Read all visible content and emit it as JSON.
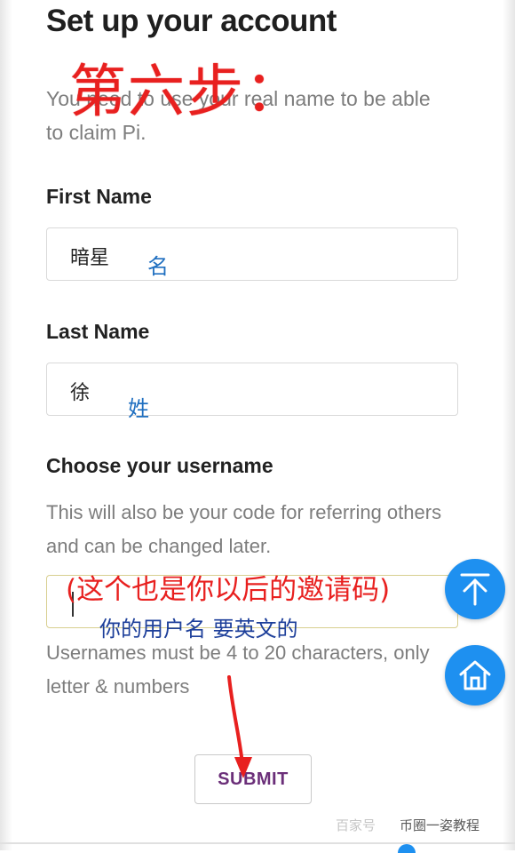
{
  "page": {
    "title": "Set up your account",
    "intro": "You need to use your real name to be able to claim Pi."
  },
  "first_name": {
    "label": "First Name",
    "value": "暗星"
  },
  "last_name": {
    "label": "Last Name",
    "value": "徐"
  },
  "username": {
    "label": "Choose your username",
    "help": "This will also be your code for referring others and can be changed later.",
    "value": "",
    "rule": "Usernames must be 4 to 20 characters, only letter & numbers"
  },
  "submit_label": "SUBMIT",
  "annotations": {
    "step": "第六步：",
    "first_name_note": "名",
    "last_name_note": "姓",
    "referral_note": "(这个也是你以后的邀请码)",
    "username_note": "你的用户名 要英文的"
  },
  "watermark": {
    "left": "百家号",
    "right": "币圈一姿教程"
  },
  "colors": {
    "fab": "#1e90f0",
    "submit_text": "#6b2f79",
    "annotation_red": "#e8201f",
    "annotation_blue": "#1f6fc0"
  },
  "icons": [
    "scroll-top-icon",
    "home-icon",
    "arrow-annotation"
  ]
}
